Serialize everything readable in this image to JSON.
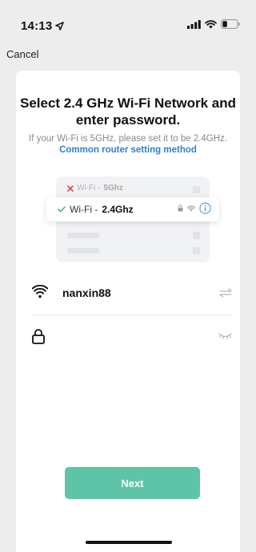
{
  "status_bar": {
    "time": "14:13"
  },
  "nav": {
    "cancel_label": "Cancel"
  },
  "content": {
    "title": "Select 2.4 GHz Wi-Fi Network and enter password.",
    "subtitle_text": "If your Wi-Fi is 5GHz, please set it to be 2.4GHz. ",
    "subtitle_link": "Common router setting method"
  },
  "illustration": {
    "row_5g_prefix": "Wi-Fi - ",
    "row_5g_band": "5Ghz",
    "row_24g_prefix": "Wi-Fi - ",
    "row_24g_band": "2.4Ghz"
  },
  "form": {
    "ssid": "nanxin88",
    "password_value": "",
    "password_placeholder": ""
  },
  "actions": {
    "next_label": "Next"
  },
  "colors": {
    "primary": "#5ec4a8",
    "link": "#2f7fd0",
    "check": "#3dbb8f",
    "cross": "#e0484b"
  },
  "icons": {
    "location": "location-arrow-icon",
    "signal": "cellular-signal-icon",
    "wifi": "wifi-icon",
    "battery": "battery-icon",
    "lock": "lock-icon",
    "switch": "switch-arrows-icon",
    "eye": "eye-closed-icon"
  }
}
